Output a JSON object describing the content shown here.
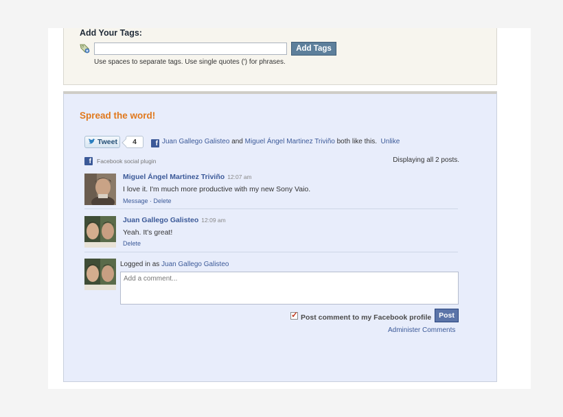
{
  "tags": {
    "title": "Add Your Tags:",
    "input_value": "",
    "button_label": "Add Tags",
    "hint": "Use spaces to separate tags. Use single quotes (') for phrases."
  },
  "share": {
    "title": "Spread the word!",
    "tweet_label": "Tweet",
    "tweet_count": "4",
    "like_user_1": "Juan Gallego Galisteo",
    "like_and": "and",
    "like_user_2": "Miguel Ángel Martinez Triviño",
    "like_suffix": "both like this.",
    "unlike_label": "Unlike"
  },
  "comments": {
    "plugin_label": "Facebook social plugin",
    "displaying": "Displaying all 2 posts.",
    "posts": [
      {
        "author": "Miguel Ángel Martinez Triviño",
        "time": "12:07 am",
        "text": "I love it. I'm much more productive with my new Sony Vaio.",
        "message_label": "Message",
        "separator": " · ",
        "delete_label": "Delete"
      },
      {
        "author": "Juan Gallego Galisteo",
        "time": "12:09 am",
        "text": "Yeah. It's great!",
        "delete_label": "Delete"
      }
    ],
    "logged_in_prefix": "Logged in as",
    "logged_in_user": "Juan Gallego Galisteo",
    "comment_placeholder": "Add a comment...",
    "post_to_profile_label": "Post comment to my Facebook profile",
    "post_to_profile_checked": true,
    "post_button": "Post",
    "administer_label": "Administer Comments"
  },
  "colors": {
    "accent_orange": "#e0781c",
    "facebook_blue": "#3b5998",
    "panel_bg": "#e8edfb"
  },
  "icons": {
    "tag": "tag-icon",
    "facebook": "facebook-icon",
    "twitter": "twitter-bird-icon"
  }
}
